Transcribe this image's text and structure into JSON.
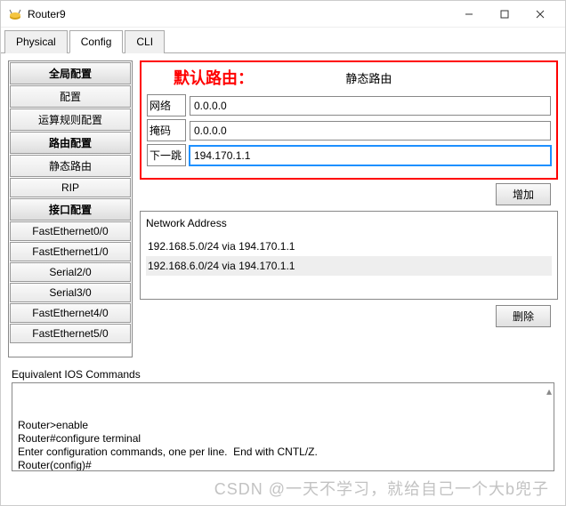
{
  "window": {
    "title": "Router9"
  },
  "tabs": [
    {
      "label": "Physical",
      "active": false
    },
    {
      "label": "Config",
      "active": true
    },
    {
      "label": "CLI",
      "active": false
    }
  ],
  "sidebar": {
    "headers": {
      "global": "全局配置",
      "routing": "路由配置",
      "interface": "接口配置"
    },
    "items": {
      "settings": "配置",
      "algorithm": "运算规则配置",
      "static": "静态路由",
      "rip": "RIP",
      "fe00": "FastEthernet0/0",
      "fe10": "FastEthernet1/0",
      "s20": "Serial2/0",
      "s30": "Serial3/0",
      "fe40": "FastEthernet4/0",
      "fe50": "FastEthernet5/0"
    }
  },
  "main": {
    "annotation": "默认路由：",
    "section_title": "静态路由",
    "form": {
      "network_label": "网络",
      "network_value": "0.0.0.0",
      "mask_label": "掩码",
      "mask_value": "0.0.0.0",
      "nexthop_label": "下一跳",
      "nexthop_value": "194.170.1.1"
    },
    "add_btn": "增加",
    "delete_btn": "删除",
    "list_header": "Network Address",
    "routes": [
      "192.168.5.0/24 via 194.170.1.1",
      "192.168.6.0/24 via 194.170.1.1"
    ]
  },
  "ios": {
    "label": "Equivalent IOS Commands",
    "text": "Router>enable\nRouter#configure terminal\nEnter configuration commands, one per line.  End with CNTL/Z.\nRouter(config)#"
  },
  "watermark": "CSDN @一天不学习，就给自己一个大b兜子"
}
